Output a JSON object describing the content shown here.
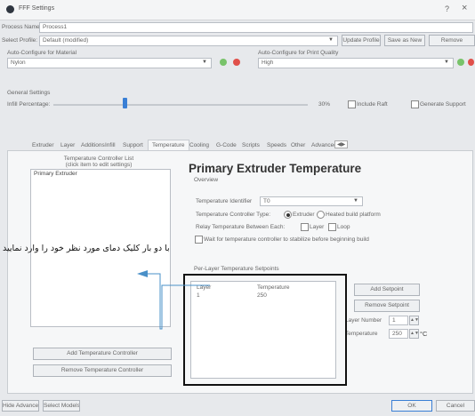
{
  "window": {
    "title": "FFF Settings",
    "help_glyph": "?",
    "close_glyph": "×"
  },
  "process": {
    "name_label": "Process Name:",
    "name_value": "Process1"
  },
  "profile": {
    "label": "Select Profile:",
    "value": "Default (modified)",
    "update_btn": "Update Profile",
    "save_as_btn": "Save as New",
    "remove_btn": "Remove"
  },
  "material": {
    "label": "Auto-Configure for Material",
    "value": "Nylon"
  },
  "quality": {
    "label": "Auto-Configure for Print Quality",
    "value": "High"
  },
  "general": {
    "label": "General Settings",
    "infill_label": "Infill Percentage:",
    "infill_value": "30%",
    "infill_fraction": 0.28,
    "include_raft": "Include Raft",
    "generate_support": "Generate Support"
  },
  "tabs": [
    "Extruder",
    "Layer",
    "Additions",
    "Infill",
    "Support",
    "Temperature",
    "Cooling",
    "G-Code",
    "Scripts",
    "Speeds",
    "Other",
    "Advanced"
  ],
  "active_tab": "Temperature",
  "controller_list": {
    "heading": "Temperature Controller List",
    "subheading": "(click item to edit settings)",
    "items": [
      "Primary Extruder"
    ],
    "add_btn": "Add Temperature Controller",
    "remove_btn": "Remove Temperature Controller"
  },
  "temp": {
    "title": "Primary Extruder Temperature",
    "overview": "Overview",
    "identifier_label": "Temperature Identifier",
    "identifier_value": "T0",
    "ctrl_type_label": "Temperature Controller Type:",
    "opt_extruder": "Extruder",
    "opt_bed": "Heated build platform",
    "relay_label": "Relay Temperature Between Each:",
    "opt_layer": "Layer",
    "opt_loop": "Loop",
    "wait_label": "Wait for temperature controller to stabilize before beginning build"
  },
  "setpoints": {
    "label": "Per-Layer Temperature Setpoints",
    "col_layer": "Layer",
    "col_temp": "Temperature",
    "rows": [
      {
        "layer": "1",
        "temp": "250"
      }
    ],
    "add_btn": "Add Setpoint",
    "remove_btn": "Remove Setpoint",
    "layer_num_label": "Layer Number",
    "layer_num_value": "1",
    "temp_label": "Temperature",
    "temp_value": "250",
    "unit": "°C"
  },
  "footer": {
    "hide_adv": "Hide Advanced",
    "select_models": "Select Models",
    "ok": "OK",
    "cancel": "Cancel"
  },
  "annotation": {
    "text": "با دو بار کلیک دمای مورد نظر خود را وارد نمایید"
  },
  "colors": {
    "accent": "#3a7fd5",
    "highlight": "#111111",
    "arrow": "#4a90c8"
  }
}
